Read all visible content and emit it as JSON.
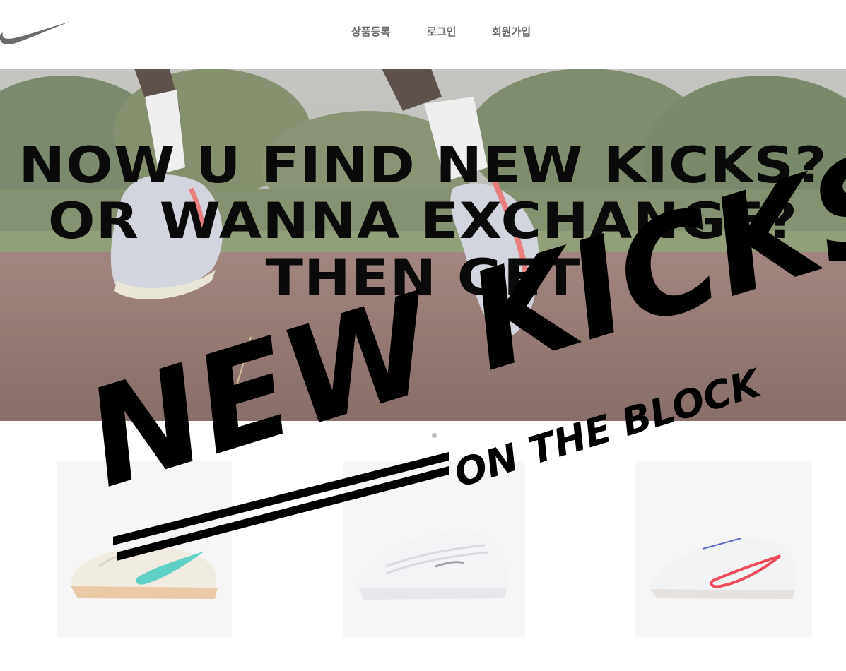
{
  "nav": {
    "items": [
      {
        "label": "상품등록"
      },
      {
        "label": "로그인"
      },
      {
        "label": "회원가입"
      }
    ]
  },
  "hero": {
    "lines": [
      "NOW U FIND NEW KICKS?",
      "OR WANNA EXCHANGE?",
      "THEN GET"
    ]
  },
  "brand": {
    "title": "NEW KICKS",
    "subtitle": "ON THE BLOCK"
  },
  "products": [
    {
      "icon": "sneaker-cream-teal-swoosh"
    },
    {
      "icon": "sneaker-white-air-max"
    },
    {
      "icon": "sneaker-white-red-swoosh"
    }
  ],
  "colors": {
    "nav_text": "#666666",
    "headline": "#0a0a0a",
    "product_bg": "#f6f6f6"
  }
}
